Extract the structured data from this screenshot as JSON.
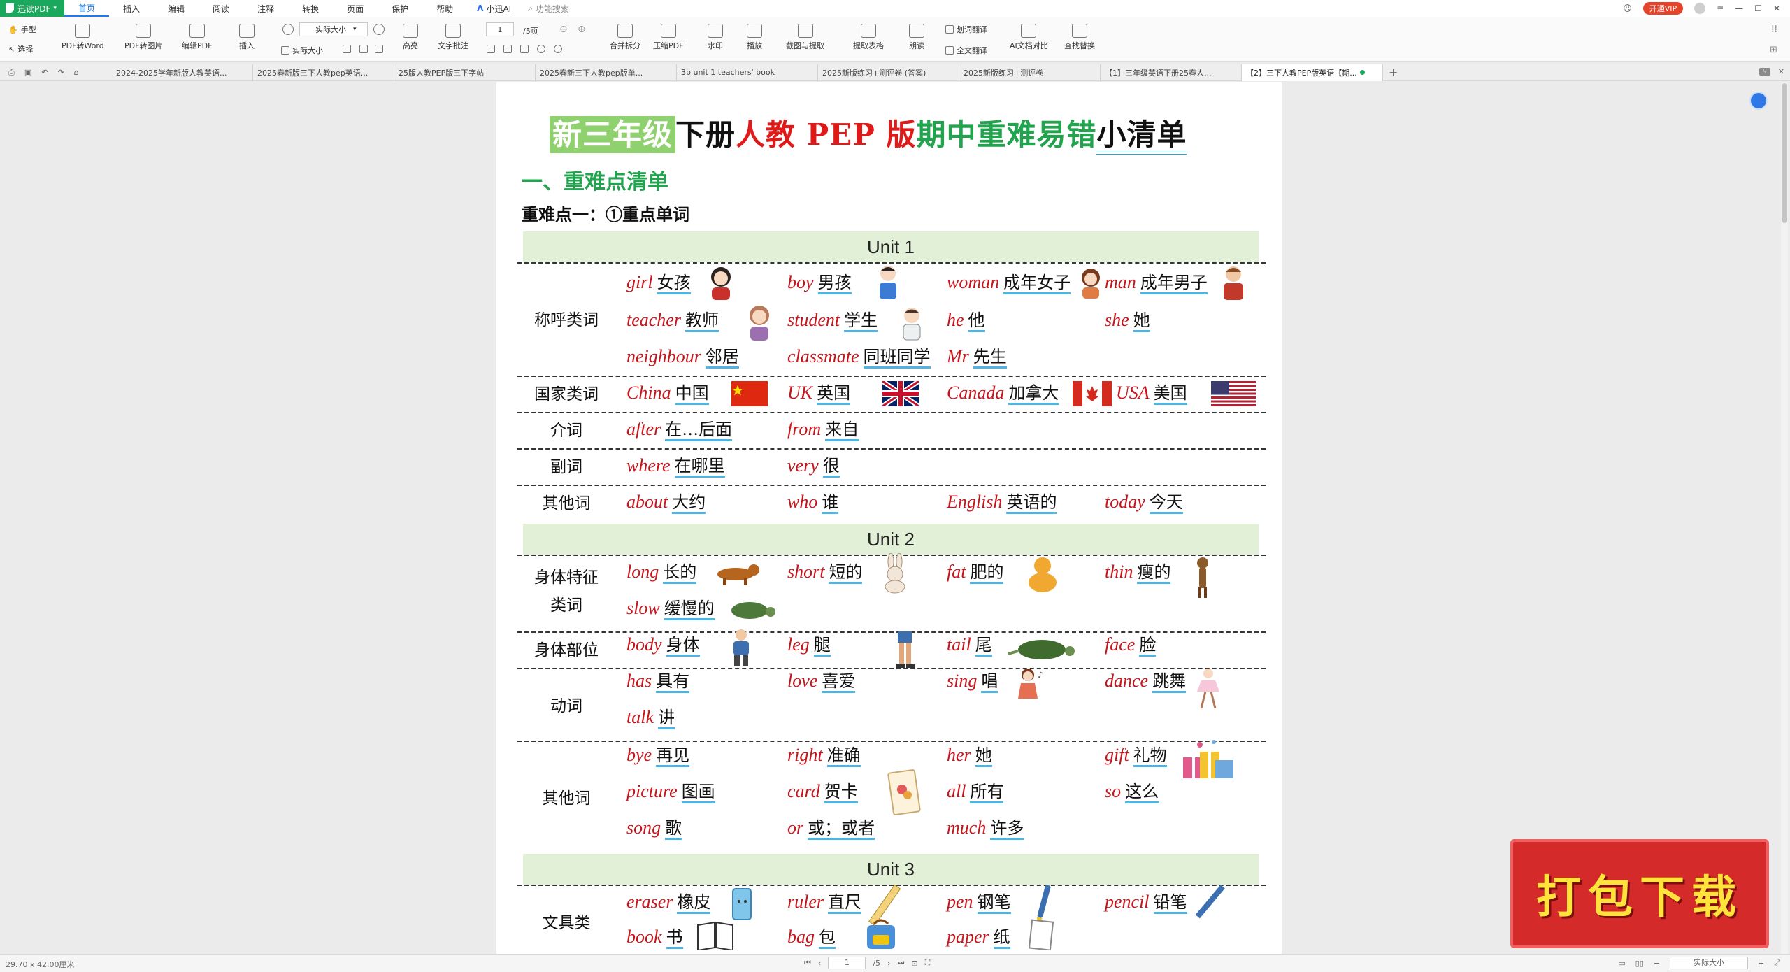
{
  "menubar": {
    "app_name": "迅读PDF",
    "items": [
      "首页",
      "插入",
      "编辑",
      "阅读",
      "注释",
      "转换",
      "页面",
      "保护",
      "帮助"
    ],
    "ai_label": "小迅AI",
    "search_label": "功能搜索",
    "vip_label": "开通VIP"
  },
  "toolbar": {
    "hand_tool": "手型",
    "select_tool": "选择",
    "pdf_to_word": "PDF转Word",
    "pdf_to_image": "PDF转图片",
    "edit_pdf": "编辑PDF",
    "insert": "插入",
    "zoom_value": "实际大小",
    "actual_size": "实际大小",
    "page_current": "1",
    "page_total": "/5页",
    "highlight": "高亮",
    "text_comment": "文字批注",
    "merge_split": "合并拆分",
    "compress_pdf": "压缩PDF",
    "watermark": "水印",
    "play": "播放",
    "screenshot_extract": "截图与提取",
    "extract_table": "提取表格",
    "read_aloud": "朗读",
    "word_translate": "划词翻译",
    "full_translate": "全文翻译",
    "ai_compare": "AI文档对比",
    "find_replace": "查找替换"
  },
  "tabs": [
    "2024-2025学年新版人教英语...",
    "2025春新版三下人教pep英语...",
    "25版人教PEP版三下字帖",
    "2025春新三下人教pep版单...",
    "3b unit 1 teachers' book",
    "2025新版练习+测评卷 (答案)",
    "2025新版练习+测评卷",
    "【1】三年级英语下册25春人...",
    "【2】三下人教PEP版英语【期..."
  ],
  "tab_count": "9",
  "document": {
    "title_parts": [
      "新三年级",
      "下册",
      "人教 PEP 版",
      "期中重难易错",
      "小清单"
    ],
    "section_title": "一、重难点清单",
    "subsection_title": "重难点一：①重点单词",
    "units": [
      "Unit 1",
      "Unit 2",
      "Unit 3"
    ],
    "categories": {
      "u1_address": "称呼类词",
      "u1_country": "国家类词",
      "u1_prep": "介词",
      "u1_adverb": "副词",
      "u1_other": "其他词",
      "u2_body_feature_a": "身体特征",
      "u2_body_feature_b": "类词",
      "u2_body_part": "身体部位",
      "u2_verb": "动词",
      "u2_other": "其他词",
      "u3_stationery": "文具类"
    },
    "words": {
      "girl": {
        "en": "girl",
        "zh": "女孩"
      },
      "boy": {
        "en": "boy",
        "zh": "男孩"
      },
      "woman": {
        "en": "woman",
        "zh": "成年女子"
      },
      "man": {
        "en": "man",
        "zh": "成年男子"
      },
      "teacher": {
        "en": "teacher",
        "zh": "教师"
      },
      "student": {
        "en": "student",
        "zh": "学生"
      },
      "he": {
        "en": "he",
        "zh": "他"
      },
      "she": {
        "en": "she",
        "zh": "她"
      },
      "neighbour": {
        "en": "neighbour",
        "zh": "邻居"
      },
      "classmate": {
        "en": "classmate",
        "zh": "同班同学"
      },
      "mr": {
        "en": "Mr",
        "zh": "先生"
      },
      "china": {
        "en": "China",
        "zh": "中国"
      },
      "uk": {
        "en": "UK",
        "zh": "英国"
      },
      "canada": {
        "en": "Canada",
        "zh": "加拿大"
      },
      "usa": {
        "en": "USA",
        "zh": "美国"
      },
      "after": {
        "en": "after",
        "zh": "在…后面"
      },
      "from": {
        "en": "from",
        "zh": "来自"
      },
      "where": {
        "en": "where",
        "zh": "在哪里"
      },
      "very": {
        "en": "very",
        "zh": "很"
      },
      "about": {
        "en": "about",
        "zh": "大约"
      },
      "who": {
        "en": "who",
        "zh": "谁"
      },
      "english": {
        "en": "English",
        "zh": "英语的"
      },
      "today": {
        "en": "today",
        "zh": "今天"
      },
      "long": {
        "en": "long",
        "zh": "长的"
      },
      "short": {
        "en": "short",
        "zh": "短的"
      },
      "fat": {
        "en": "fat",
        "zh": "肥的"
      },
      "thin": {
        "en": "thin",
        "zh": "瘦的"
      },
      "slow": {
        "en": "slow",
        "zh": "缓慢的"
      },
      "body": {
        "en": "body",
        "zh": "身体"
      },
      "leg": {
        "en": "leg",
        "zh": "腿"
      },
      "tail": {
        "en": "tail",
        "zh": "尾"
      },
      "face": {
        "en": "face",
        "zh": "脸"
      },
      "has": {
        "en": "has",
        "zh": "具有"
      },
      "love": {
        "en": "love",
        "zh": "喜爱"
      },
      "sing": {
        "en": "sing",
        "zh": "唱"
      },
      "dance": {
        "en": "dance",
        "zh": "跳舞"
      },
      "talk": {
        "en": "talk",
        "zh": "讲"
      },
      "bye": {
        "en": "bye",
        "zh": "再见"
      },
      "right": {
        "en": "right",
        "zh": "准确"
      },
      "her": {
        "en": "her",
        "zh": "她"
      },
      "gift": {
        "en": "gift",
        "zh": "礼物"
      },
      "picture": {
        "en": "picture",
        "zh": "图画"
      },
      "card": {
        "en": "card",
        "zh": "贺卡"
      },
      "all": {
        "en": "all",
        "zh": "所有"
      },
      "so": {
        "en": "so",
        "zh": "这么"
      },
      "song": {
        "en": "song",
        "zh": "歌"
      },
      "or": {
        "en": "or",
        "zh": "或；或者"
      },
      "much": {
        "en": "much",
        "zh": "许多"
      },
      "eraser": {
        "en": "eraser",
        "zh": "橡皮"
      },
      "ruler": {
        "en": "ruler",
        "zh": "直尺"
      },
      "pen": {
        "en": "pen",
        "zh": "钢笔"
      },
      "pencil": {
        "en": "pencil",
        "zh": "铅笔"
      },
      "book": {
        "en": "book",
        "zh": "书"
      },
      "bag": {
        "en": "bag",
        "zh": "包"
      },
      "paper": {
        "en": "paper",
        "zh": "纸"
      }
    }
  },
  "statusbar": {
    "page_size": "29.70 x 42.00厘米",
    "page_current": "1",
    "page_total": "/5",
    "zoom": "实际大小"
  },
  "banner": {
    "label": "打包下载"
  },
  "colors": {
    "accent": "#1d7bf2",
    "brand": "#1aa85c",
    "word_en": "#c4161c",
    "title_green": "#22a44f",
    "unit_bg": "#e2f0d8",
    "banner": "#d42a2a"
  }
}
